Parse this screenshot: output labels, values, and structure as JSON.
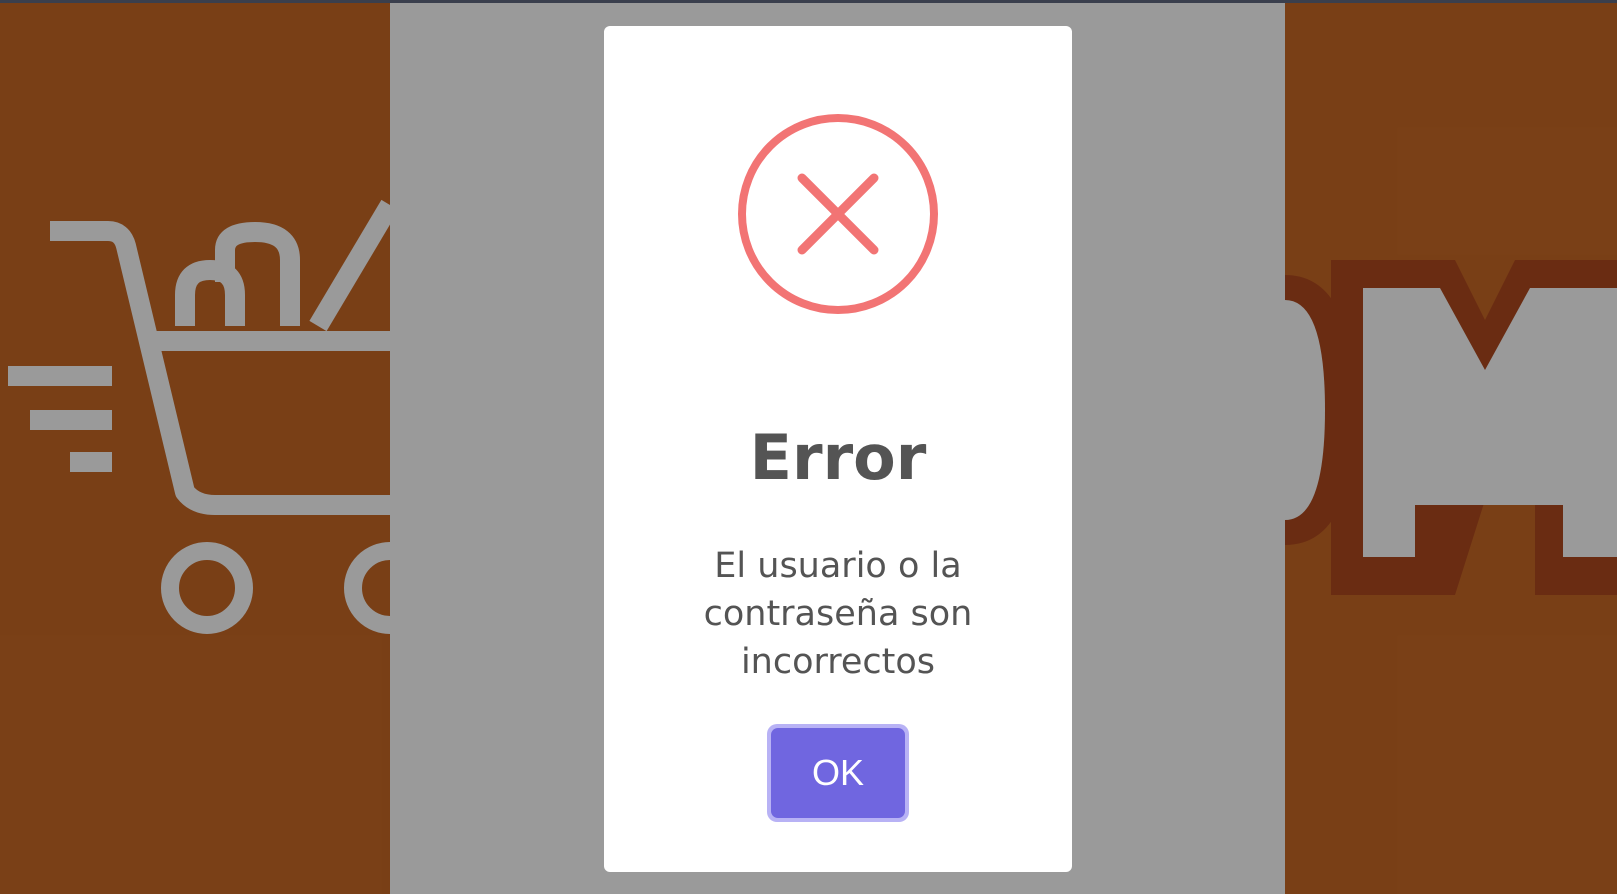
{
  "dialog": {
    "icon": "error-x-icon",
    "title": "Error",
    "message": "El usuario o la contraseña son incorrectos",
    "confirm_label": "OK"
  },
  "colors": {
    "brand_orange": "#c45a10",
    "error_red": "#f27474",
    "confirm_button": "#7066e0",
    "text": "#545454"
  }
}
